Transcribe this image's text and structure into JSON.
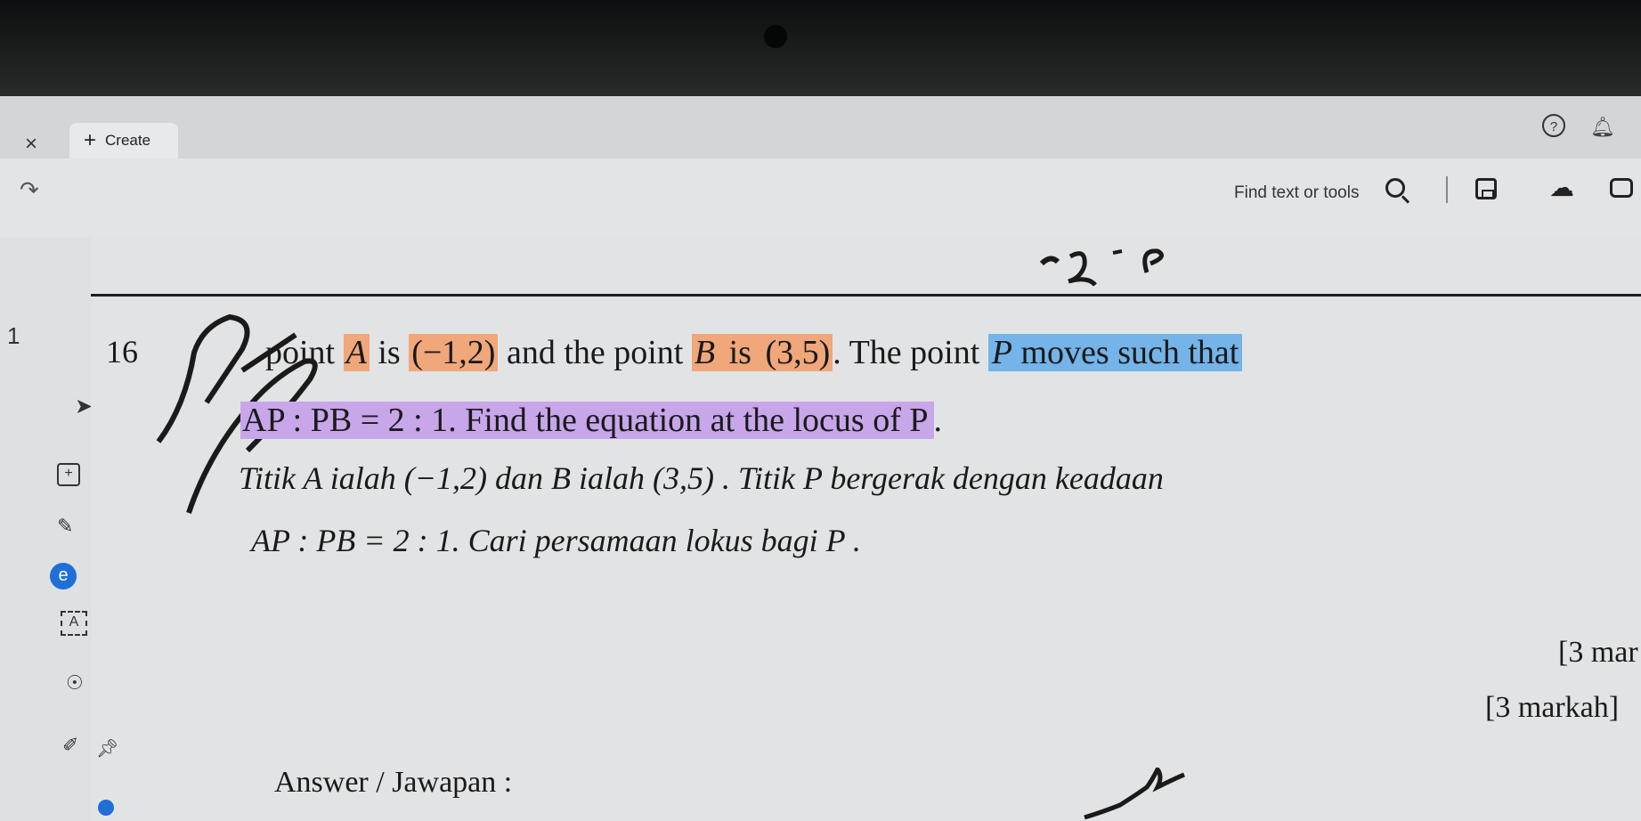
{
  "window": {
    "tab_close": "×",
    "create_tab": {
      "icon": "+",
      "label": "Create"
    },
    "help_icon": "?"
  },
  "toolbar": {
    "find_label": "Find text or tools"
  },
  "rail": {
    "page_number": "1",
    "textbox_glyph": "A"
  },
  "colors": {
    "highlight_orange": "#f0a77a",
    "highlight_blue": "#74b4e8",
    "highlight_purple": "#c7a6ea",
    "accent_blue": "#1f6fd8"
  },
  "question": {
    "number": "16",
    "en_line1": {
      "pre": "point ",
      "A": "A",
      "is1": " is ",
      "pointA": "(−1,2)",
      "mid": " and the point ",
      "B": "B",
      "is2": " is ",
      "pointB": "(3,5)",
      "post": ". The point ",
      "P": "P",
      "tail": " moves such that"
    },
    "en_line2": {
      "ratio": "AP : PB = 2 : 1. Find the equation at the locus of P",
      "end": "."
    },
    "ms_line1": "Titik A ialah (−1,2) dan B ialah (3,5) . Titik P bergerak dengan keadaan",
    "ms_line2": "AP : PB = 2 : 1. Cari persamaan lokus bagi P .",
    "marks_en": "[3 mar",
    "marks_ms": "[3 markah]",
    "answer_label": "Answer / Jawapan :"
  }
}
